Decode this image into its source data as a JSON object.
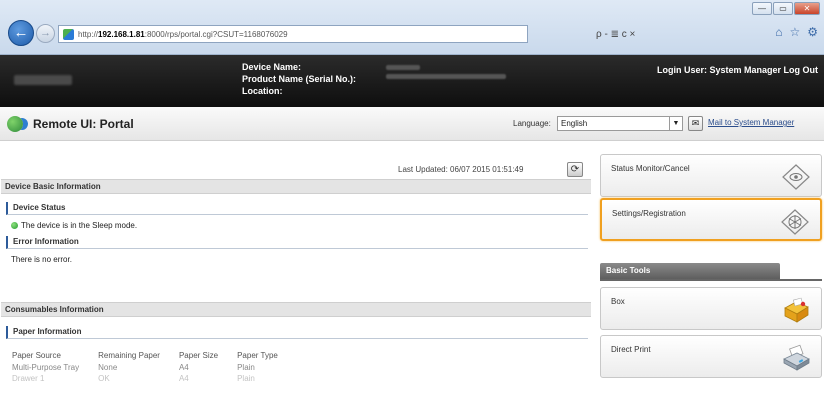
{
  "browser": {
    "url_prefix": "http://",
    "url_host": "192.168.1.81",
    "url_rest": ":8000/rps/portal.cgi?CSUT=1168076029",
    "search_text": "ρ - ≣ c ×",
    "window_controls": [
      "—",
      "▭",
      "✕"
    ]
  },
  "device_header": {
    "device_name_label": "Device Name:",
    "product_name_label": "Product Name (Serial No.):",
    "location_label": "Location:",
    "login_text": "Login User: System Manager Log Out"
  },
  "portal": {
    "title": "Remote UI: Portal",
    "language_label": "Language:",
    "language_value": "English",
    "mail_link": "Mail to System Manager"
  },
  "main": {
    "last_updated": "Last Updated: 06/07 2015 01:51:49",
    "device_basic_info": "Device Basic Information",
    "device_status_head": "Device Status",
    "device_status_text": "The device is in the Sleep mode.",
    "error_info_head": "Error Information",
    "error_info_text": "There is no error.",
    "consumables_head": "Consumables Information",
    "paper_info_head": "Paper Information",
    "paper_table": {
      "headers": [
        "Paper Source",
        "Remaining Paper",
        "Paper Size",
        "Paper Type"
      ],
      "rows": [
        [
          "Multi-Purpose Tray",
          "None",
          "A4",
          "Plain"
        ],
        [
          "Drawer 1",
          "OK",
          "A4",
          "Plain"
        ]
      ]
    }
  },
  "right_panel": {
    "status_monitor": "Status Monitor/Cancel",
    "settings_registration": "Settings/Registration",
    "basic_tools": "Basic Tools",
    "box": "Box",
    "direct_print": "Direct Print"
  }
}
